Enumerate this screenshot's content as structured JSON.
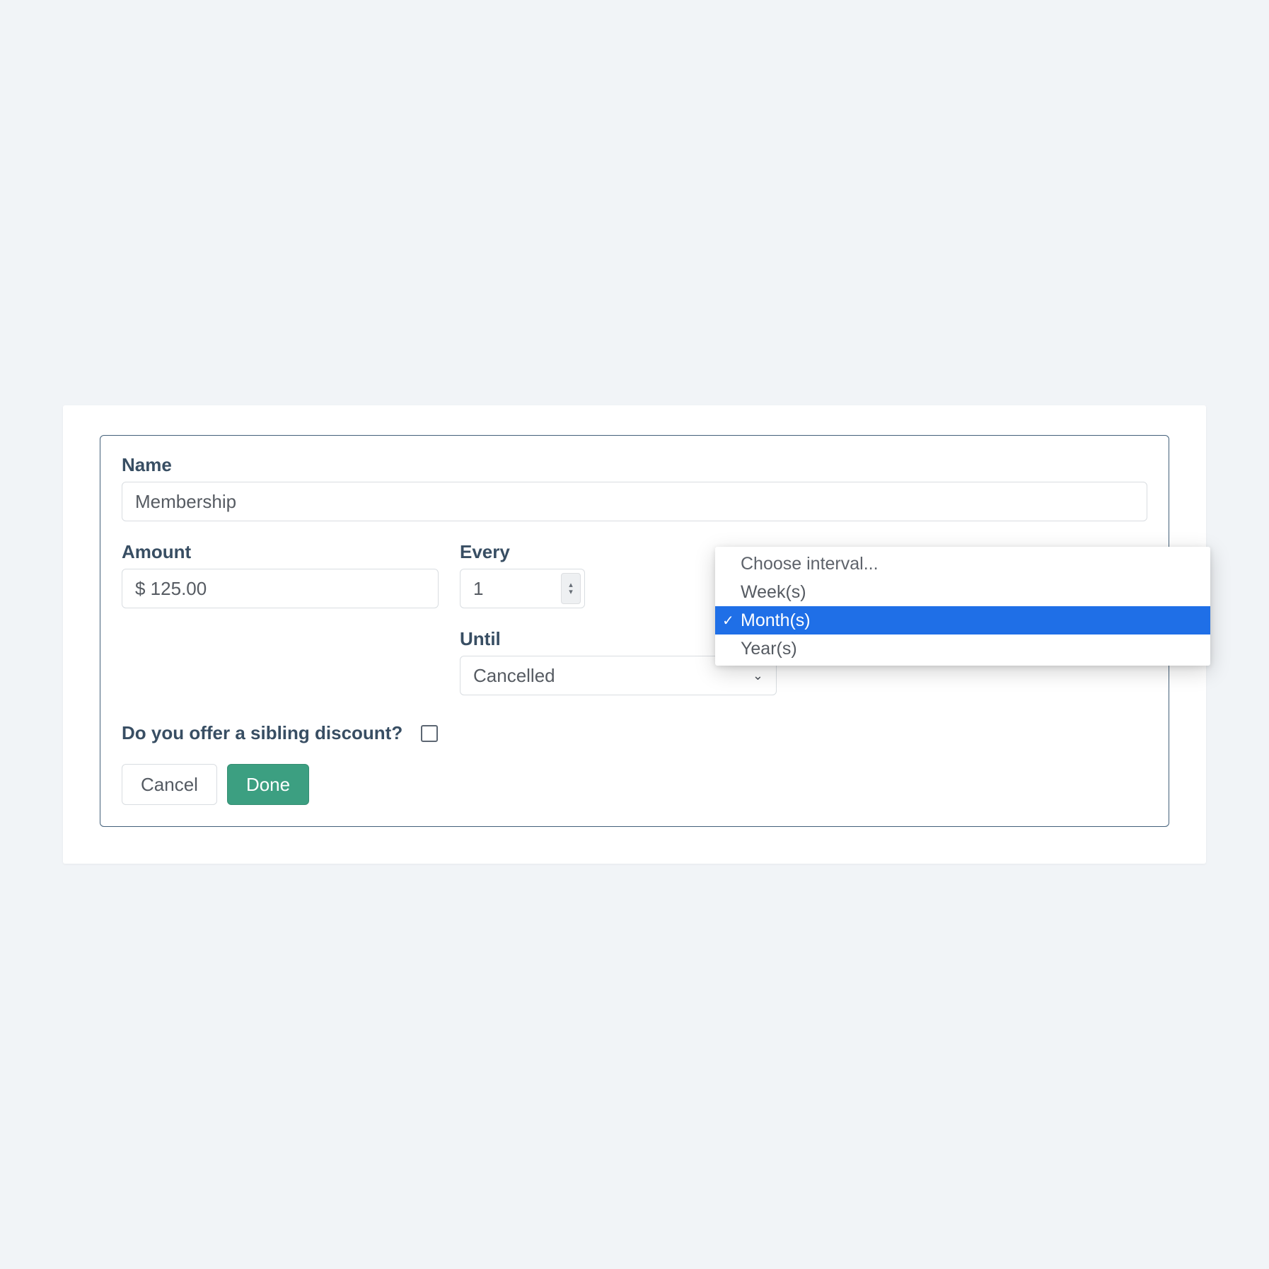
{
  "labels": {
    "name": "Name",
    "amount": "Amount",
    "every": "Every",
    "until": "Until",
    "sibling": "Do you offer a sibling discount?"
  },
  "fields": {
    "name_value": "Membership",
    "amount_value": "$ 125.00",
    "every_value": "1",
    "until_value": "Cancelled",
    "sibling_checked": false
  },
  "interval_dropdown": {
    "placeholder": "Choose interval...",
    "options": [
      "Week(s)",
      "Month(s)",
      "Year(s)"
    ],
    "selected": "Month(s)"
  },
  "buttons": {
    "cancel": "Cancel",
    "done": "Done"
  }
}
